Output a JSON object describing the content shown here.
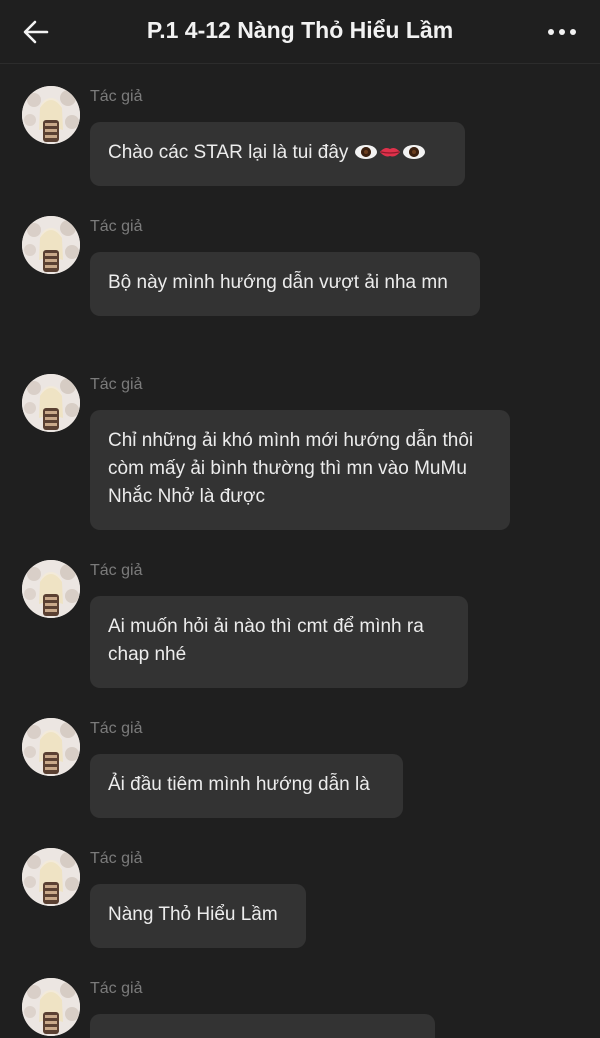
{
  "header": {
    "title": "P.1 4-12 Nàng Thỏ Hiểu Lầm"
  },
  "messages": [
    {
      "author": "Tác giả",
      "text": "Chào các STAR lại là tui đây"
    },
    {
      "author": "Tác giả",
      "text": "Bộ này mình hướng dẫn vượt ải nha mn"
    },
    {
      "author": "Tác giả",
      "lines": [
        "Chỉ những ải khó mình mới hướng dẫn thôi",
        "còm mấy ải bình thường thì mn vào MuMu",
        "Nhắc Nhở là được"
      ]
    },
    {
      "author": "Tác giả",
      "lines": [
        "Ai muốn hỏi ải nào thì cmt để mình ra",
        "chap nhé"
      ]
    },
    {
      "author": "Tác giả",
      "text": "Ải đầu tiêm mình hướng dẫn là"
    },
    {
      "author": "Tác giả",
      "text": "Nàng Thỏ Hiểu Lầm"
    },
    {
      "author": "Tác giả",
      "text": ""
    }
  ]
}
